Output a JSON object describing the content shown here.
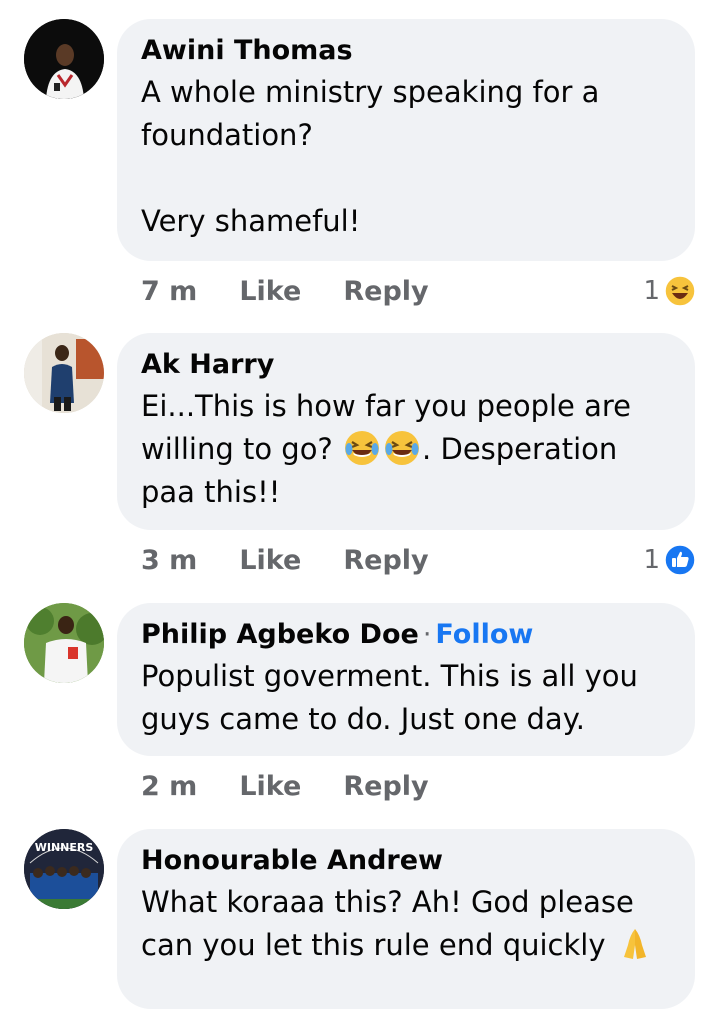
{
  "comments": [
    {
      "author": "Awini Thomas",
      "text": "A whole ministry speaking for a\nfoundation?\n\nVery shameful!",
      "time": "7 m",
      "like": "Like",
      "reply": "Reply",
      "reaction_count": "1",
      "reaction_icon": "haha-reaction-icon"
    },
    {
      "author": "Ak Harry",
      "text_before": "Ei...This is how far you people are\nwilling to go? ",
      "emojis": [
        "face-with-tears-of-joy-icon",
        "face-with-tears-of-joy-icon"
      ],
      "text_after": ". Desperation\npaa this!!",
      "time": "3 m",
      "like": "Like",
      "reply": "Reply",
      "reaction_count": "1",
      "reaction_icon": "like-reaction-icon"
    },
    {
      "author": "Philip Agbeko Doe",
      "separator": "·",
      "follow": "Follow",
      "text": "Populist goverment. This is all you\nguys came to do. Just one day.",
      "time": "2 m",
      "like": "Like",
      "reply": "Reply"
    },
    {
      "author": "Honourable Andrew",
      "avatar_text": "WINNERS",
      "text": "What koraaa this? Ah! God please\ncan you let this rule end quickly",
      "trailing_emoji": "folded-hands-icon"
    }
  ],
  "colors": {
    "bubble": "#f0f2f5",
    "meta_text": "#65676b",
    "follow": "#1877f2",
    "like_reaction": "#1877f2",
    "haha_reaction": "#f7c33c"
  }
}
